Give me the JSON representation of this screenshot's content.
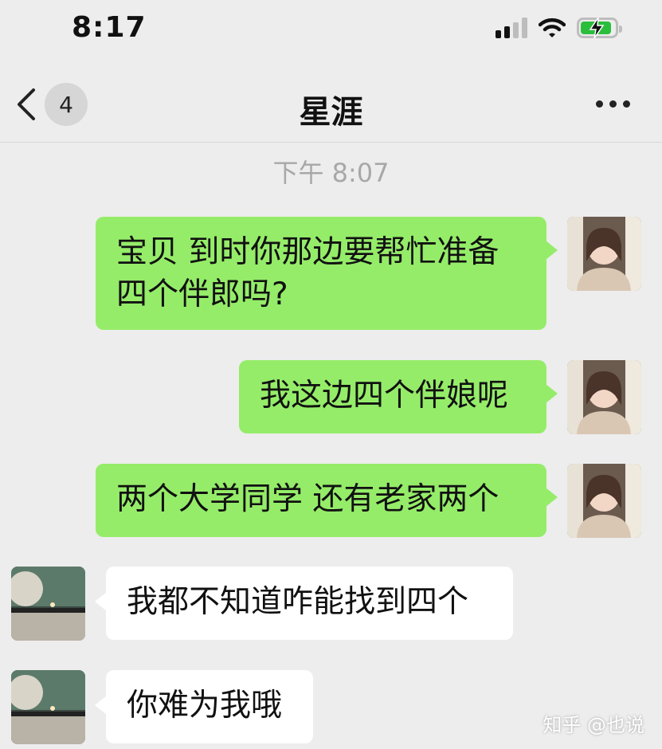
{
  "status_bar": {
    "time": "8:17",
    "signal_icon": "signal-bars-icon",
    "wifi_icon": "wifi-icon",
    "battery_icon": "battery-charging-icon"
  },
  "nav": {
    "back_icon": "chevron-left-icon",
    "unread_count": "4",
    "title": "星涯",
    "more_icon": "more-dots-icon"
  },
  "chat": {
    "timestamp": "下午 8:07",
    "messages": [
      {
        "direction": "out",
        "text": "宝贝 到时你那边要帮忙准备\n四个伴郎吗?"
      },
      {
        "direction": "out",
        "text": "我这边四个伴娘呢"
      },
      {
        "direction": "out",
        "text": "两个大学同学 还有老家两个"
      },
      {
        "direction": "in",
        "text": "我都不知道咋能找到四个"
      },
      {
        "direction": "in",
        "text": "你难为我哦"
      }
    ]
  },
  "watermark": "知乎 @也说",
  "colors": {
    "background": "#ededed",
    "outgoing_bubble": "#95ec69",
    "incoming_bubble": "#ffffff",
    "timestamp_text": "#a8a8a8"
  }
}
